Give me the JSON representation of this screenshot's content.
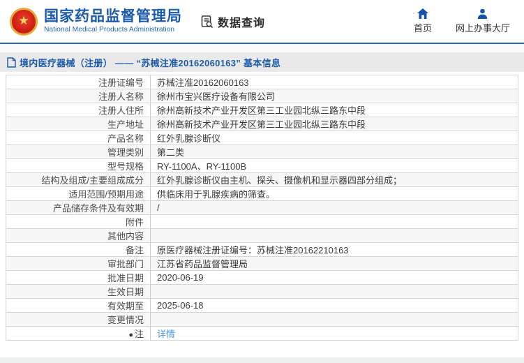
{
  "header": {
    "logo": {
      "emblem_icon": "china-national-emblem",
      "title": "国家药品监督管理局",
      "subtitle": "National Medical Products Administration",
      "title_color": "#1b5bab"
    },
    "section": {
      "icon": "doc-search-icon",
      "label": "数据查询"
    },
    "nav": [
      {
        "icon": "home-icon",
        "label": "首页"
      },
      {
        "icon": "user-icon",
        "label": "网上办事大厅"
      }
    ],
    "divider_color": "#2a6aa5",
    "icon_color": "#1553a8"
  },
  "title_bar": {
    "icon": "document-icon",
    "text": "境内医疗器械（注册） —— “苏械注准20162060163” 基本信息",
    "text_color": "#1c5aa8",
    "bg_color": "#e9e9e9"
  },
  "table": {
    "alt_row_bg": "#f7f7f7",
    "border_color": "#d6d6d6",
    "link_color": "#4a94d8",
    "rows": [
      {
        "label": "注册证编号",
        "value": "苏械注准20162060163"
      },
      {
        "label": "注册人名称",
        "value": "徐州市宝兴医疗设备有限公司"
      },
      {
        "label": "注册人住所",
        "value": "徐州高新技术产业开发区第三工业园北纵三路东中段"
      },
      {
        "label": "生产地址",
        "value": "徐州高新技术产业开发区第三工业园北纵三路东中段"
      },
      {
        "label": "产品名称",
        "value": "红外乳腺诊断仪"
      },
      {
        "label": "管理类别",
        "value": "第二类"
      },
      {
        "label": "型号规格",
        "value": "RY-1100A、RY-1100B"
      },
      {
        "label": "结构及组成/主要组成成分",
        "value": "红外乳腺诊断仪由主机、探头、摄像机和显示器四部分组成；"
      },
      {
        "label": "适用范围/预期用途",
        "value": "供临床用于乳腺疾病的筛查。"
      },
      {
        "label": "产品储存条件及有效期",
        "value": "/"
      },
      {
        "label": "附件",
        "value": ""
      },
      {
        "label": "其他内容",
        "value": ""
      },
      {
        "label": "备注",
        "value": "原医疗器械注册证编号：苏械注准20162210163"
      },
      {
        "label": "审批部门",
        "value": "江苏省药品监督管理局"
      },
      {
        "label": "批准日期",
        "value": "2020-06-19"
      },
      {
        "label": "生效日期",
        "value": ""
      },
      {
        "label": "有效期至",
        "value": "2025-06-18"
      },
      {
        "label": "变更情况",
        "value": ""
      },
      {
        "label": "注",
        "label_icon": "●",
        "value": "详情",
        "value_is_link": true
      }
    ]
  }
}
